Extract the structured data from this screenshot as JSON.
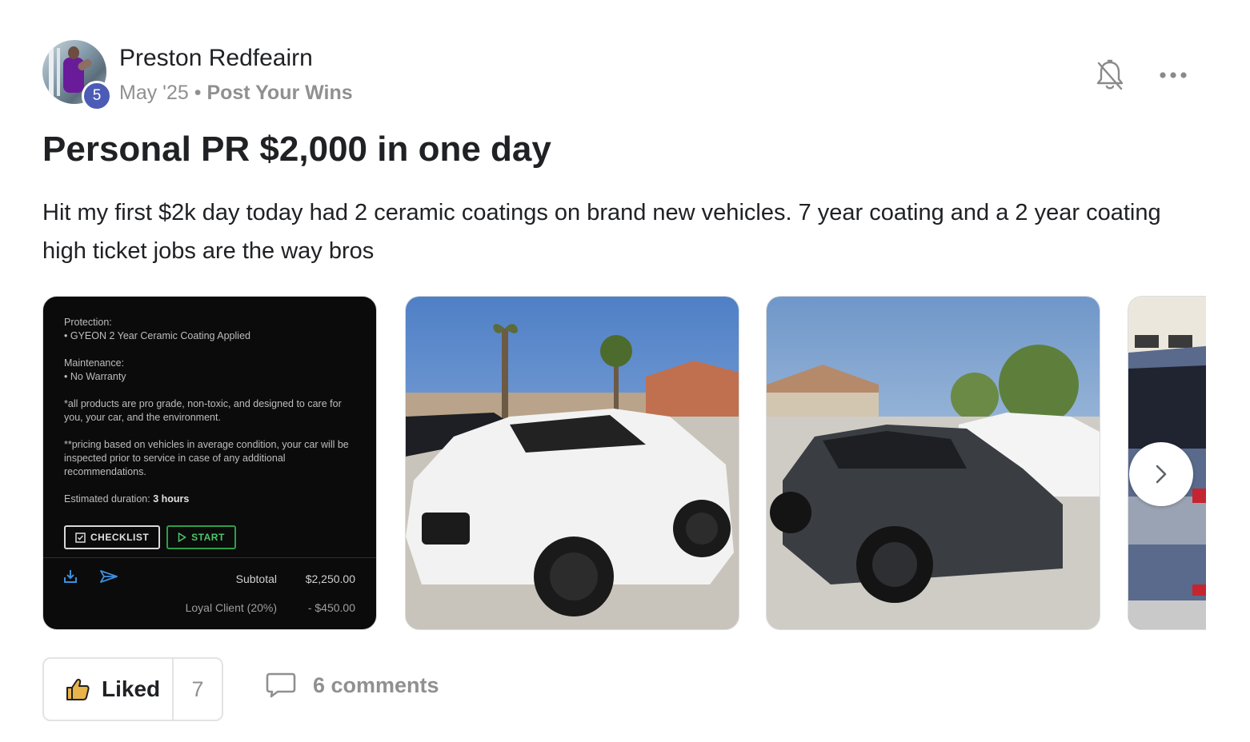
{
  "post": {
    "author": "Preston Redfeairn",
    "level": "5",
    "date": "May '25",
    "separator": "•",
    "category": "Post Your Wins",
    "title": "Personal PR $2,000 in one day",
    "body": "Hit my first $2k day today had 2 ceramic coatings on brand new vehicles. 7 year coating and a 2 year coating high ticket jobs are the way bros"
  },
  "gallery": {
    "invoice": {
      "protection_label": "Protection:",
      "protection_item": "• GYEON 2 Year Ceramic Coating Applied",
      "maintenance_label": "Maintenance:",
      "maintenance_item": "• No Warranty",
      "note1": "*all products are pro grade, non-toxic, and designed to care for you, your car, and the environment.",
      "note2": "**pricing based on vehicles in average condition, your car will be inspected prior to service in case of any additional recommendations.",
      "duration_label": "Estimated duration:",
      "duration_value": "3 hours",
      "checklist_label": "CHECKLIST",
      "start_label": "START",
      "subtotal_label": "Subtotal",
      "subtotal_value": "$2,250.00",
      "discount_label": "Loyal Client (20%)",
      "discount_value": "- $450.00"
    },
    "images": [
      {
        "subject": "invoice-screenshot"
      },
      {
        "subject": "white-mercedes-suv"
      },
      {
        "subject": "dark-gray-audi-suv"
      },
      {
        "subject": "blue-suv-rear"
      }
    ]
  },
  "actions": {
    "like_label": "Liked",
    "like_count": "7",
    "comments_label": "6 comments"
  },
  "icons": {
    "bell": "bell-off-icon",
    "more": "more-horizontal-icon",
    "like": "thumbs-up-icon",
    "comment": "comment-icon",
    "next": "chevron-right-icon"
  },
  "colors": {
    "level_badge": "#4c5bb5",
    "meta_text": "#909090",
    "start_green": "#2e9d4b"
  }
}
